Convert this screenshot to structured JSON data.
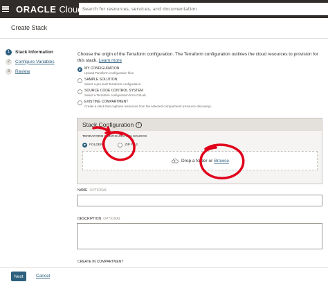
{
  "header": {
    "brand_main": "ORACLE",
    "brand_sub": "Cloud",
    "search_placeholder": "Search for resources, services, and documentation"
  },
  "page": {
    "title": "Create Stack"
  },
  "steps": [
    {
      "num": "1",
      "label": "Stack Information"
    },
    {
      "num": "2",
      "label": "Configure Variables"
    },
    {
      "num": "3",
      "label": "Review"
    }
  ],
  "intro": {
    "text": "Choose the origin of the Terraform configuration. The Terraform configuration outlines the cloud resources to provision for this stack.",
    "link": "Learn more"
  },
  "origin_options": [
    {
      "title": "MY CONFIGURATION",
      "desc": "Upload Terraform configuration files.",
      "selected": true
    },
    {
      "title": "SAMPLE SOLUTION",
      "desc": "Select a pre-built Terraform configuration.",
      "selected": false
    },
    {
      "title": "SOURCE CODE CONTROL SYSTEM",
      "desc": "Select a Terraform configuration from GitLab.",
      "selected": false
    },
    {
      "title": "EXISTING COMPARTMENT",
      "desc": "Create a stack that captures resources from the selected compartment (resource discovery).",
      "selected": false
    }
  ],
  "stack_config": {
    "title": "Stack Configuration",
    "info_glyph": "i",
    "source_label": "TERRAFORM CONFIGURATION SOURCE",
    "folder_label": "FOLDER",
    "zip_label": "ZIP FILE",
    "drop_text": "Drop a folder",
    "or_text": "or",
    "browse": "Browse"
  },
  "fields": {
    "name_label": "NAME",
    "description_label": "DESCRIPTION",
    "optional": "OPTIONAL",
    "compartment_label": "CREATE IN COMPARTMENT"
  },
  "footer": {
    "next": "Next",
    "cancel": "Cancel"
  },
  "colors": {
    "accent": "#2d5f7e",
    "topbar": "#312d2a",
    "annotation": "#e0001b"
  }
}
